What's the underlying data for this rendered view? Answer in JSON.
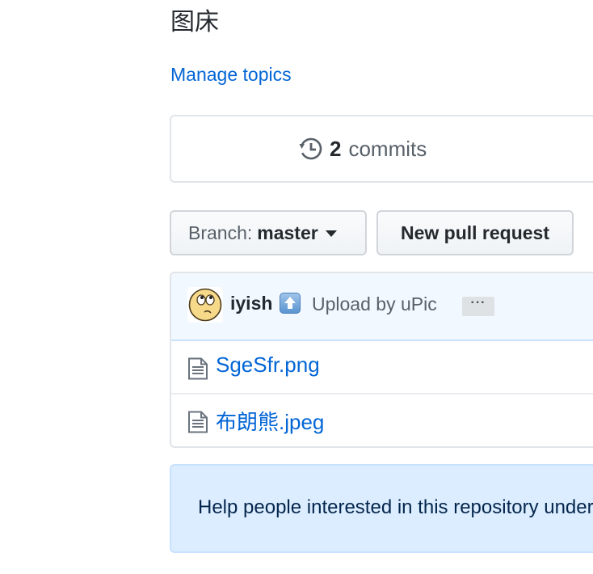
{
  "repo": {
    "description": "图床",
    "manage_topics_label": "Manage topics"
  },
  "summary": {
    "commits_count": "2",
    "commits_label": "commits",
    "icon": "history-icon"
  },
  "toolbar": {
    "branch_prefix": "Branch:",
    "branch_name": "master",
    "new_pull_request_label": "New pull request"
  },
  "latest_commit": {
    "author": "iyish",
    "emoji": "arrow-up-emoji",
    "message": "Upload by uPic",
    "ellipsis_label": "···"
  },
  "files": [
    {
      "name": "SgeSfr.png",
      "icon": "file-icon"
    },
    {
      "name": "布朗熊.jpeg",
      "icon": "file-icon"
    }
  ],
  "readme_prompt": {
    "text": "Help people interested in this repository understand your project by adding a README."
  },
  "colors": {
    "link": "#0366d6",
    "text": "#24292e",
    "muted": "#586069",
    "commit_tease_bg": "#f1f8ff",
    "readme_bg": "#dbedff",
    "border": "#e1e4e8"
  }
}
